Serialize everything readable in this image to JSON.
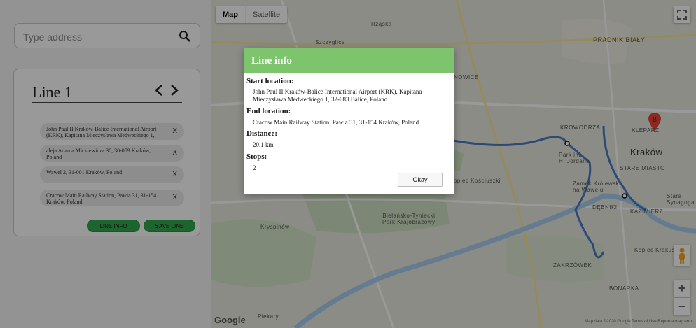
{
  "search": {
    "placeholder": "Type address"
  },
  "line_card": {
    "title": "Line 1",
    "stops": [
      {
        "text": "John Paul II Kraków-Balice International Airport (KRK), Kapitana Mieczysława Medweckiego 1,",
        "remove": "X"
      },
      {
        "text": "aleja Adama Mickiewicza 30, 30-059 Kraków, Poland",
        "remove": "X"
      },
      {
        "text": "Wawel 2, 31-001 Kraków, Poland",
        "remove": "X"
      },
      {
        "text": "Cracow Main Railway Station, Pawia 31, 31-154 Kraków, Poland",
        "remove": "X"
      }
    ],
    "line_info_label": "LINE INFO",
    "save_line_label": "SAVE LINE"
  },
  "map": {
    "type_map": "Map",
    "type_satellite": "Satellite",
    "labels": {
      "rzaska": "Rząska",
      "szczyglice": "Szczyglice",
      "pradnik": "PRĄDNIK BIAŁY",
      "nowice": "NOWICE",
      "krowodrza": "KROWODRZA",
      "park_jordana": "Park im.\nH. Jordana",
      "klepar": "KLEPARZ",
      "krakow": "Kraków",
      "stare_miasto": "STARE MIASTO",
      "zamek": "Zamek Królewski\nna Wawelu",
      "stara_synagoga": "Stara Synagoga",
      "debniki": "DĘBNIKI",
      "kazimierz": "KAZIMIERZ",
      "kopiec": "Kopiec Kościuszki",
      "bielansko": "Bielańsko-Tyniecki\nPark Krajobrazowy",
      "kryspinow": "Kryspinów",
      "zakrzowek": "ZAKRZÓWEK",
      "kopiec_krakusa": "Kopiec Krakusa",
      "bonarka": "BONARKA",
      "piekary": "Piekary"
    },
    "marker_label": "B",
    "zoom_in": "+",
    "zoom_out": "−",
    "google": "Google",
    "attribution": "Map data ©2020 Google    Terms of Use    Report a map error"
  },
  "modal": {
    "title": "Line info",
    "start_label": "Start location:",
    "start_value": "John Paul II Kraków-Balice International Airport (KRK), Kapitana Mieczysława Medweckiego 1, 32-083 Balice, Poland",
    "end_label": "End location:",
    "end_value": "Cracow Main Railway Station, Pawia 31, 31-154 Kraków, Poland",
    "distance_label": "Distance:",
    "distance_value": "20.1 km",
    "stops_label": "Stops:",
    "stops_value": "2",
    "okay_label": "Okay"
  }
}
